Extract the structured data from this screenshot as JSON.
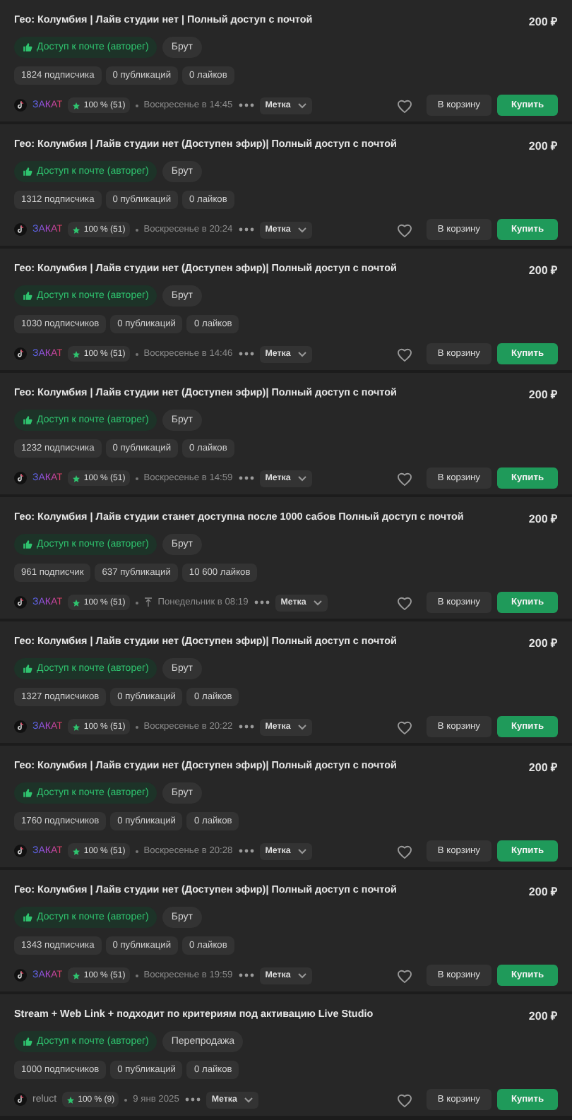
{
  "listings": [
    {
      "title": "Гео: Колумбия | Лайв студии нет | Полный доступ с почтой",
      "price": "200 ₽",
      "tags": [
        {
          "text": "Доступ к почте (авторег)",
          "kind": "mail"
        },
        {
          "text": "Брут",
          "kind": "plain"
        }
      ],
      "stats": [
        "1824 подписчика",
        "0 публикаций",
        "0 лайков"
      ],
      "seller": {
        "name": "ЗАКАТ",
        "kind": "gradient"
      },
      "rating": "100 % (51)",
      "time": "Воскресенье в 14:45",
      "bumped": false,
      "label": "Метка",
      "cart": "В корзину",
      "buy": "Купить"
    },
    {
      "title": "Гео: Колумбия | Лайв студии нет (Доступен эфир)| Полный доступ с почтой",
      "price": "200 ₽",
      "tags": [
        {
          "text": "Доступ к почте (авторег)",
          "kind": "mail"
        },
        {
          "text": "Брут",
          "kind": "plain"
        }
      ],
      "stats": [
        "1312 подписчика",
        "0 публикаций",
        "0 лайков"
      ],
      "seller": {
        "name": "ЗАКАТ",
        "kind": "gradient"
      },
      "rating": "100 % (51)",
      "time": "Воскресенье в 20:24",
      "bumped": false,
      "label": "Метка",
      "cart": "В корзину",
      "buy": "Купить"
    },
    {
      "title": "Гео: Колумбия | Лайв студии нет (Доступен эфир)| Полный доступ с почтой",
      "price": "200 ₽",
      "tags": [
        {
          "text": "Доступ к почте (авторег)",
          "kind": "mail"
        },
        {
          "text": "Брут",
          "kind": "plain"
        }
      ],
      "stats": [
        "1030 подписчиков",
        "0 публикаций",
        "0 лайков"
      ],
      "seller": {
        "name": "ЗАКАТ",
        "kind": "gradient"
      },
      "rating": "100 % (51)",
      "time": "Воскресенье в 14:46",
      "bumped": false,
      "label": "Метка",
      "cart": "В корзину",
      "buy": "Купить"
    },
    {
      "title": "Гео: Колумбия | Лайв студии нет (Доступен эфир)| Полный доступ с почтой",
      "price": "200 ₽",
      "tags": [
        {
          "text": "Доступ к почте (авторег)",
          "kind": "mail"
        },
        {
          "text": "Брут",
          "kind": "plain"
        }
      ],
      "stats": [
        "1232 подписчика",
        "0 публикаций",
        "0 лайков"
      ],
      "seller": {
        "name": "ЗАКАТ",
        "kind": "gradient"
      },
      "rating": "100 % (51)",
      "time": "Воскресенье в 14:59",
      "bumped": false,
      "label": "Метка",
      "cart": "В корзину",
      "buy": "Купить"
    },
    {
      "title": "Гео: Колумбия | Лайв студии станет доступна после 1000 сабов Полный доступ с почтой",
      "price": "200 ₽",
      "tags": [
        {
          "text": "Доступ к почте (авторег)",
          "kind": "mail"
        },
        {
          "text": "Брут",
          "kind": "plain"
        }
      ],
      "stats": [
        "961 подписчик",
        "637 публикаций",
        "10 600 лайков"
      ],
      "seller": {
        "name": "ЗАКАТ",
        "kind": "gradient"
      },
      "rating": "100 % (51)",
      "time": "Понедельник в 08:19",
      "bumped": true,
      "label": "Метка",
      "cart": "В корзину",
      "buy": "Купить"
    },
    {
      "title": "Гео: Колумбия | Лайв студии нет (Доступен эфир)| Полный доступ с почтой",
      "price": "200 ₽",
      "tags": [
        {
          "text": "Доступ к почте (авторег)",
          "kind": "mail"
        },
        {
          "text": "Брут",
          "kind": "plain"
        }
      ],
      "stats": [
        "1327 подписчиков",
        "0 публикаций",
        "0 лайков"
      ],
      "seller": {
        "name": "ЗАКАТ",
        "kind": "gradient"
      },
      "rating": "100 % (51)",
      "time": "Воскресенье в 20:22",
      "bumped": false,
      "label": "Метка",
      "cart": "В корзину",
      "buy": "Купить"
    },
    {
      "title": "Гео: Колумбия | Лайв студии нет (Доступен эфир)| Полный доступ с почтой",
      "price": "200 ₽",
      "tags": [
        {
          "text": "Доступ к почте (авторег)",
          "kind": "mail"
        },
        {
          "text": "Брут",
          "kind": "plain"
        }
      ],
      "stats": [
        "1760 подписчиков",
        "0 публикаций",
        "0 лайков"
      ],
      "seller": {
        "name": "ЗАКАТ",
        "kind": "gradient"
      },
      "rating": "100 % (51)",
      "time": "Воскресенье в 20:28",
      "bumped": false,
      "label": "Метка",
      "cart": "В корзину",
      "buy": "Купить"
    },
    {
      "title": "Гео: Колумбия | Лайв студии нет (Доступен эфир)| Полный доступ с почтой",
      "price": "200 ₽",
      "tags": [
        {
          "text": "Доступ к почте (авторег)",
          "kind": "mail"
        },
        {
          "text": "Брут",
          "kind": "plain"
        }
      ],
      "stats": [
        "1343 подписчика",
        "0 публикаций",
        "0 лайков"
      ],
      "seller": {
        "name": "ЗАКАТ",
        "kind": "gradient"
      },
      "rating": "100 % (51)",
      "time": "Воскресенье в 19:59",
      "bumped": false,
      "label": "Метка",
      "cart": "В корзину",
      "buy": "Купить"
    },
    {
      "title": "Stream + Web Link + подходит по критериям под активацию Live Studio",
      "price": "200 ₽",
      "tags": [
        {
          "text": "Доступ к почте (авторег)",
          "kind": "mail"
        },
        {
          "text": "Перепродажа",
          "kind": "plain"
        }
      ],
      "stats": [
        "1000 подписчиков",
        "0 публикаций",
        "0 лайков"
      ],
      "seller": {
        "name": "reluct",
        "kind": "plain"
      },
      "rating": "100 % (9)",
      "time": "9 янв 2025",
      "bumped": false,
      "label": "Метка",
      "cart": "В корзину",
      "buy": "Купить"
    }
  ]
}
